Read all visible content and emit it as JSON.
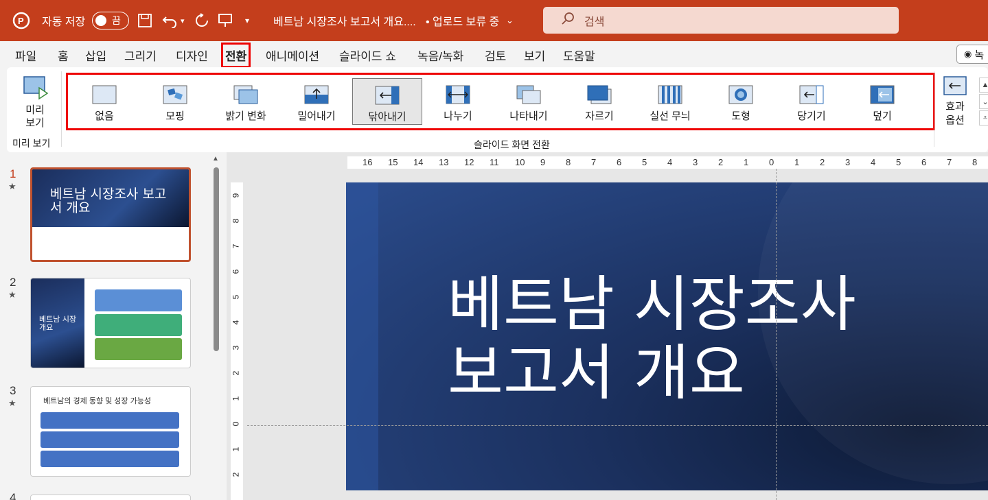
{
  "titlebar": {
    "autosave_label": "자동 저장",
    "autosave_state": "끔",
    "doc_title": "베트남 시장조사 보고서 개요....",
    "upload_status": "• 업로드 보류 중",
    "search_placeholder": "검색",
    "accent": "#c43e1c"
  },
  "menu": {
    "tabs": [
      "파일",
      "홈",
      "삽입",
      "그리기",
      "디자인",
      "전환",
      "애니메이션",
      "슬라이드 쇼",
      "녹음/녹화",
      "검토",
      "보기",
      "도움말"
    ],
    "active": "전환",
    "record_label": "녹"
  },
  "ribbon": {
    "preview_label": "미리 보기",
    "preview_group": "미리 보기",
    "transitions": [
      "없음",
      "모핑",
      "밝기 변화",
      "밀어내기",
      "닦아내기",
      "나누기",
      "나타내기",
      "자르기",
      "실선 무늬",
      "도형",
      "당기기",
      "덮기"
    ],
    "selected": "닦아내기",
    "group_label": "슬라이드 화면 전환",
    "effect_options": "효과 옵션"
  },
  "thumbnails": {
    "slides": [
      {
        "num": "1",
        "title": "베트남 시장조사 보고서 개요"
      },
      {
        "num": "2",
        "title": "베트남 시장 개요"
      },
      {
        "num": "3",
        "title": "베트남의 경제 동향 및 성장 가능성"
      },
      {
        "num": "4"
      }
    ]
  },
  "ruler": {
    "h_ticks": [
      "16",
      "15",
      "14",
      "13",
      "12",
      "11",
      "10",
      "9",
      "8",
      "7",
      "6",
      "5",
      "4",
      "3",
      "2",
      "1",
      "0",
      "1",
      "2",
      "3",
      "4",
      "5",
      "6",
      "7",
      "8"
    ],
    "v_ticks": [
      "9",
      "8",
      "7",
      "6",
      "5",
      "4",
      "3",
      "2",
      "1",
      "0",
      "1",
      "2"
    ]
  },
  "slide": {
    "title_line1": "베트남 시장조사",
    "title_line2": "보고서 개요"
  }
}
